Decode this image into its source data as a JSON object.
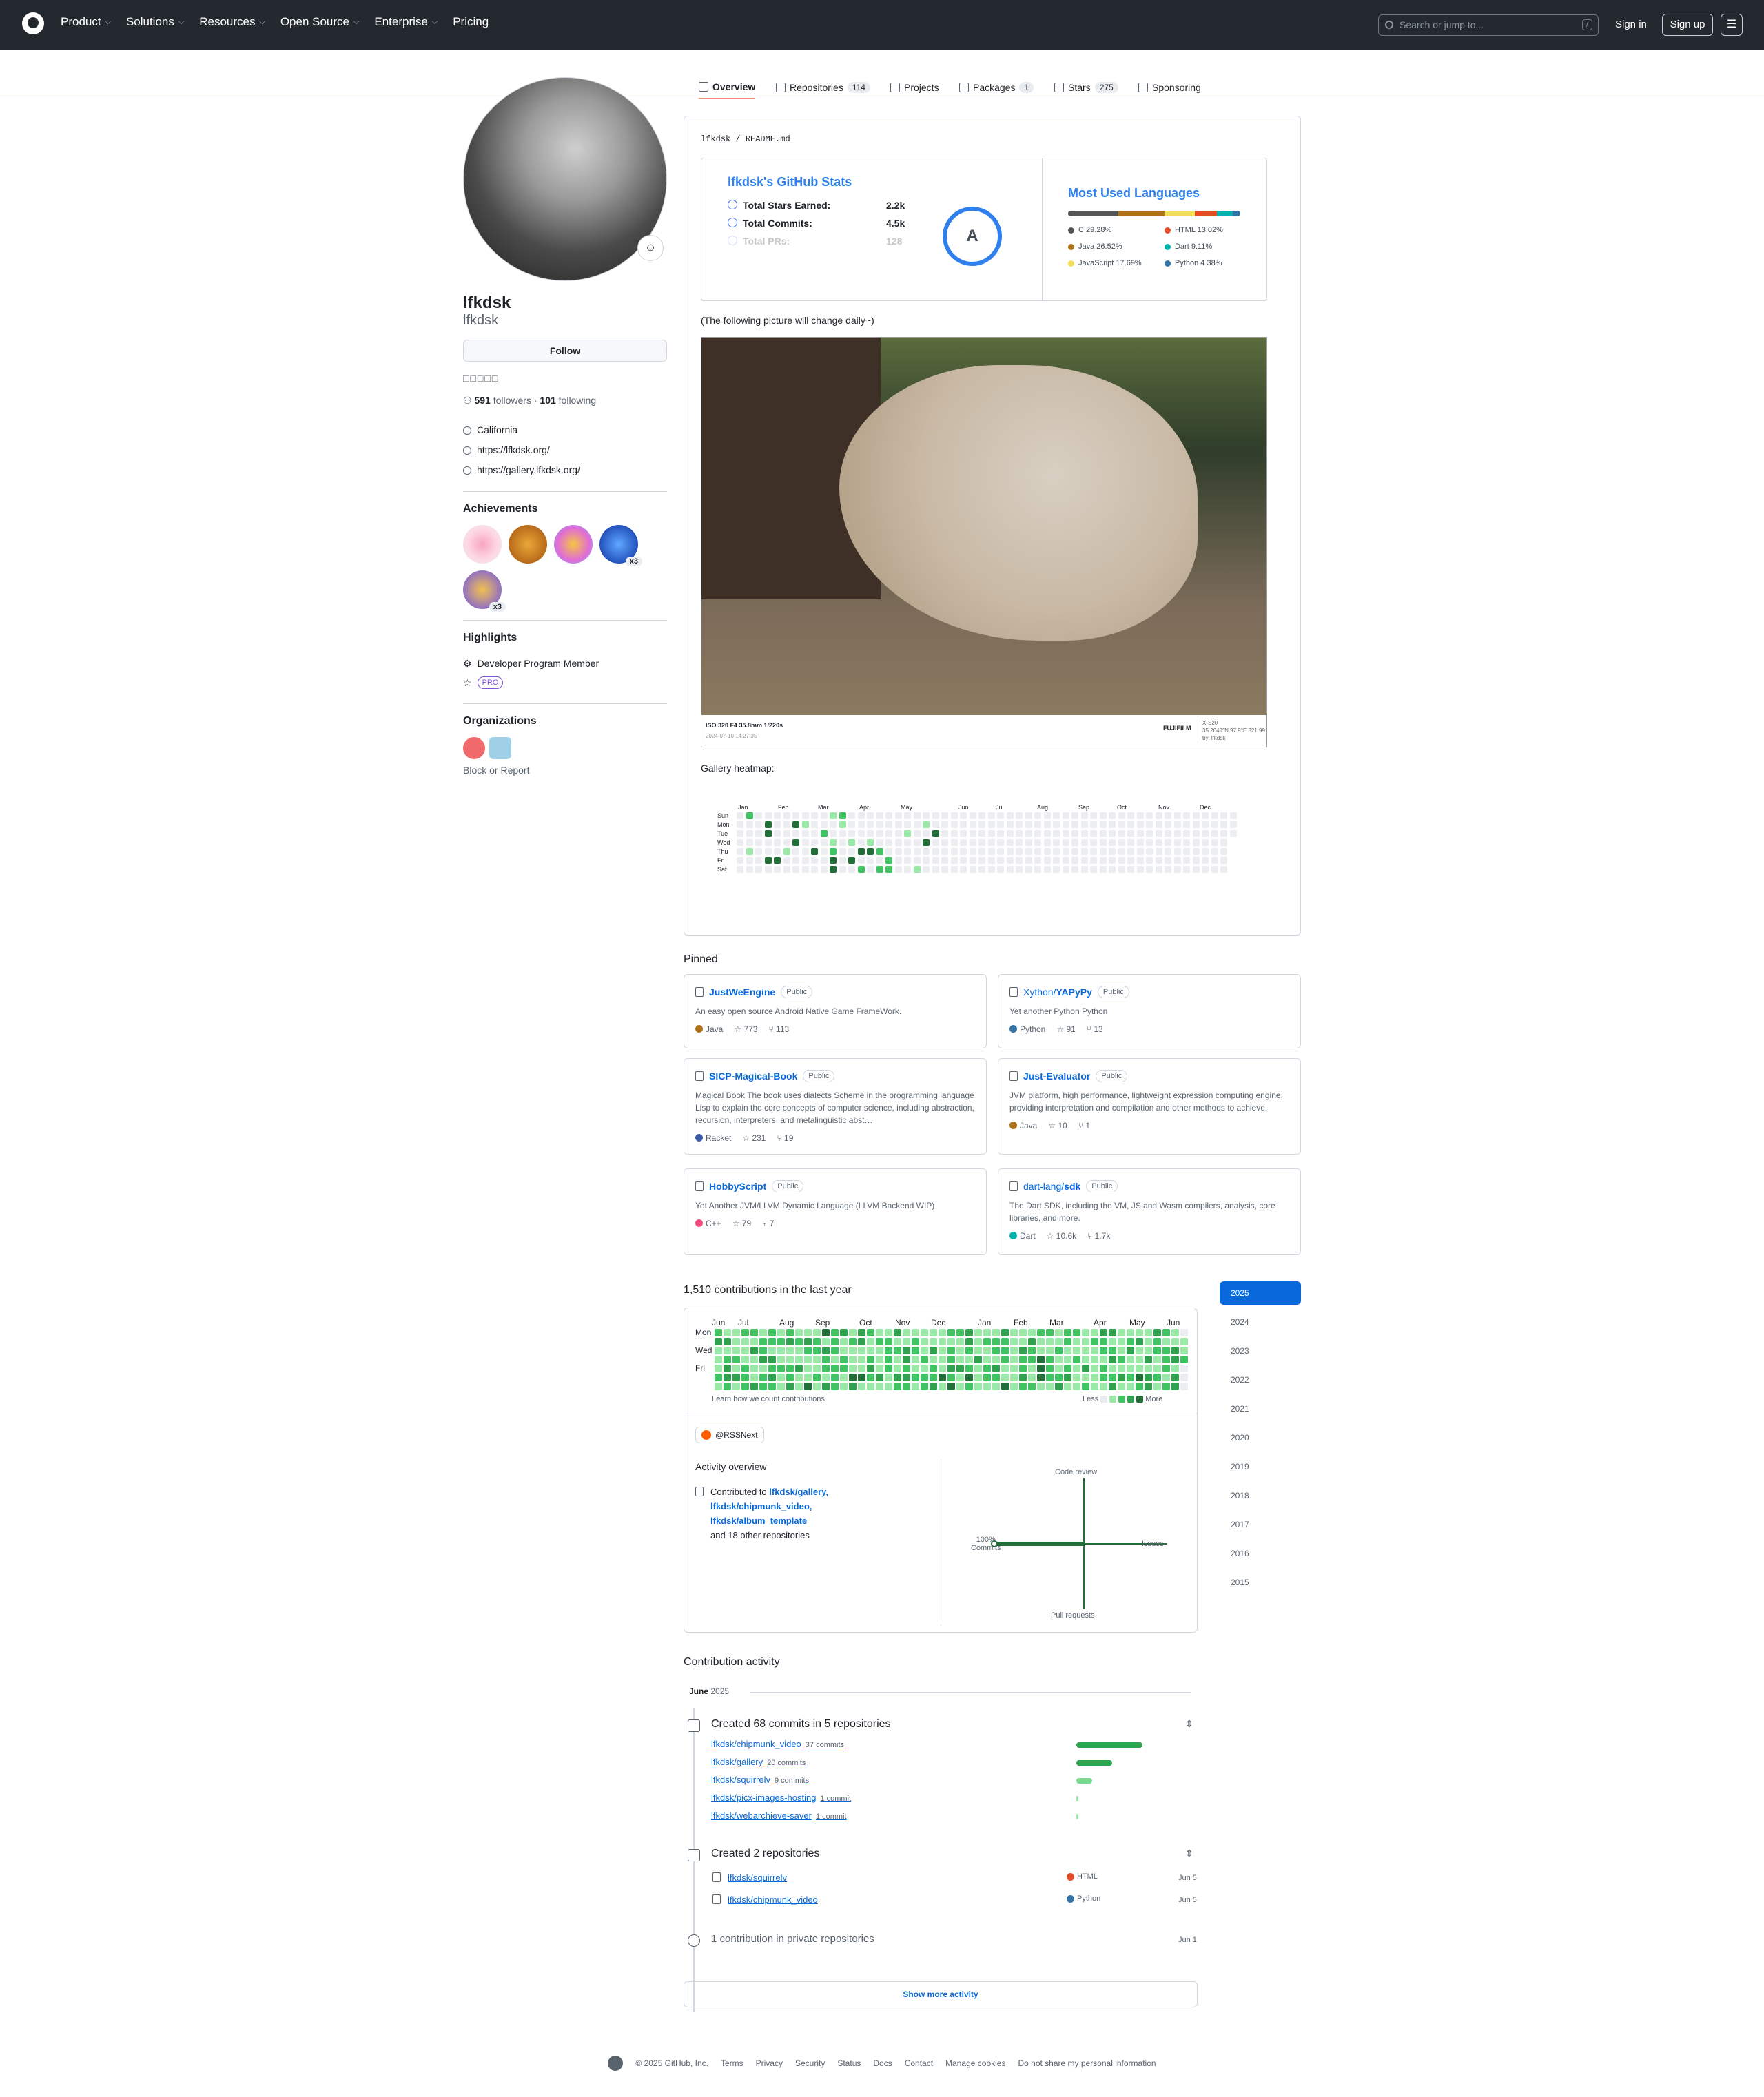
{
  "header": {
    "nav": [
      "Product",
      "Solutions",
      "Resources",
      "Open Source",
      "Enterprise",
      "Pricing"
    ],
    "search_placeholder": "Search or jump to...",
    "search_key": "/",
    "signin": "Sign in",
    "signup": "Sign up"
  },
  "tabs": [
    {
      "label": "Overview",
      "count": ""
    },
    {
      "label": "Repositories",
      "count": "114"
    },
    {
      "label": "Projects",
      "count": ""
    },
    {
      "label": "Packages",
      "count": "1"
    },
    {
      "label": "Stars",
      "count": "275"
    },
    {
      "label": "Sponsoring",
      "count": ""
    }
  ],
  "profile": {
    "name": "lfkdsk",
    "username": "lfkdsk",
    "follow": "Follow",
    "status": "□□□□□",
    "followers": "591",
    "followers_label": "followers",
    "following": "101",
    "following_label": "following",
    "location": "California",
    "links": [
      "https://lfkdsk.org/",
      "https://gallery.lfkdsk.org/"
    ],
    "achievements_title": "Achievements",
    "achievement_counts": [
      "x3",
      "x3"
    ],
    "highlights_title": "Highlights",
    "highlight_member": "Developer Program Member",
    "pro": "PRO",
    "orgs_title": "Organizations",
    "block": "Block or Report"
  },
  "readme": {
    "path_user": "lfkdsk",
    "path_file": "README.md",
    "stats_title": "lfkdsk's GitHub Stats",
    "stats": [
      {
        "label": "Total Stars Earned:",
        "value": "2.2k"
      },
      {
        "label": "Total Commits:",
        "value": "4.5k"
      },
      {
        "label": "Total PRs:",
        "value": "128"
      }
    ],
    "grade": "A",
    "lang_title": "Most Used Languages",
    "langs": [
      {
        "name": "C 29.28%",
        "color": "#555555",
        "pct": 29.28
      },
      {
        "name": "HTML 13.02%",
        "color": "#e34c26",
        "pct": 13.02
      },
      {
        "name": "Java 26.52%",
        "color": "#b07219",
        "pct": 26.52
      },
      {
        "name": "Dart 9.11%",
        "color": "#00b4ab",
        "pct": 9.11
      },
      {
        "name": "JavaScript 17.69%",
        "color": "#f1e05a",
        "pct": 17.69
      },
      {
        "name": "Python 4.38%",
        "color": "#3572a5",
        "pct": 4.38
      }
    ],
    "note": "(The following picture will change daily~)",
    "exif_main": "ISO 320 F4 35.8mm 1/220s",
    "exif_date": "2024-07-10 14:27:35",
    "exif_brand": "FUJIFILM",
    "exif_model": "X-S20",
    "exif_geo": "35.2048°N 97.9°E 321.99",
    "exif_by": "by: lfkdsk",
    "heatmap_label": "Gallery heatmap:",
    "heatmap_months": [
      "Jan",
      "Feb",
      "Mar",
      "Apr",
      "May",
      "Jun",
      "Jul",
      "Aug",
      "Sep",
      "Oct",
      "Nov",
      "Dec"
    ],
    "heatmap_days": [
      "Sun",
      "Mon",
      "Tue",
      "Wed",
      "Thu",
      "Fri",
      "Sat"
    ]
  },
  "pinned": {
    "title": "Pinned",
    "public": "Public",
    "items": [
      {
        "owner": "",
        "name": "JustWeEngine",
        "desc": "An easy open source Android Native Game FrameWork.",
        "lang": "Java",
        "color": "#b07219",
        "stars": "773",
        "forks": "113"
      },
      {
        "owner": "Xython/",
        "name": "YAPyPy",
        "desc": "Yet another Python Python",
        "lang": "Python",
        "color": "#3572a5",
        "stars": "91",
        "forks": "13"
      },
      {
        "owner": "",
        "name": "SICP-Magical-Book",
        "desc": "Magical Book The book uses dialects Scheme in the programming language Lisp to explain the core concepts of computer science, including abstraction, recursion, interpreters, and metalinguistic abst…",
        "lang": "Racket",
        "color": "#3c5caa",
        "stars": "231",
        "forks": "19"
      },
      {
        "owner": "",
        "name": "Just-Evaluator",
        "desc": "JVM platform, high performance, lightweight expression computing engine, providing interpretation and compilation and other methods to achieve.",
        "lang": "Java",
        "color": "#b07219",
        "stars": "10",
        "forks": "1"
      },
      {
        "owner": "",
        "name": "HobbyScript",
        "desc": "Yet Another JVM/LLVM Dynamic Language (LLVM Backend WIP)",
        "lang": "C++",
        "color": "#f34b7d",
        "stars": "79",
        "forks": "7"
      },
      {
        "owner": "dart-lang/",
        "name": "sdk",
        "desc": "The Dart SDK, including the VM, JS and Wasm compilers, analysis, core libraries, and more.",
        "lang": "Dart",
        "color": "#00b4ab",
        "stars": "10.6k",
        "forks": "1.7k"
      }
    ]
  },
  "contrib": {
    "title": "1,510 contributions in the last year",
    "months": [
      "Jun",
      "Jul",
      "Aug",
      "Sep",
      "Oct",
      "Nov",
      "Dec",
      "Jan",
      "Feb",
      "Mar",
      "Apr",
      "May",
      "Jun"
    ],
    "days": [
      "Mon",
      "Wed",
      "Fri"
    ],
    "learn": "Learn how we count contributions",
    "less": "Less",
    "more": "More",
    "org": "@RSSNext",
    "overview_title": "Activity overview",
    "contributed_to": "Contributed to",
    "repos": [
      "lfkdsk/gallery,",
      "lfkdsk/chipmunk_video,",
      "lfkdsk/album_template"
    ],
    "others": "and 18 other repositories",
    "axes": {
      "top": "Code review",
      "bottom": "Pull requests",
      "right": "Issues",
      "left_pct": "100%",
      "left": "Commits"
    }
  },
  "years": [
    "2025",
    "2024",
    "2023",
    "2022",
    "2021",
    "2020",
    "2019",
    "2018",
    "2017",
    "2016",
    "2015"
  ],
  "activity": {
    "title": "Contribution activity",
    "month": "June",
    "year": "2025",
    "commits_title": "Created 68 commits in 5 repositories",
    "commit_repos": [
      {
        "name": "lfkdsk/chipmunk_video",
        "count": "37 commits",
        "value": 37
      },
      {
        "name": "lfkdsk/gallery",
        "count": "20 commits",
        "value": 20
      },
      {
        "name": "lfkdsk/squirrelv",
        "count": "9 commits",
        "value": 9
      },
      {
        "name": "lfkdsk/picx-images-hosting",
        "count": "1 commit",
        "value": 1
      },
      {
        "name": "lfkdsk/webarchieve-saver",
        "count": "1 commit",
        "value": 1
      }
    ],
    "created_title": "Created 2 repositories",
    "created": [
      {
        "name": "lfkdsk/squirrelv",
        "lang": "HTML",
        "color": "#e34c26",
        "date": "Jun 5"
      },
      {
        "name": "lfkdsk/chipmunk_video",
        "lang": "Python",
        "color": "#3572a5",
        "date": "Jun 5"
      }
    ],
    "private": "1 contribution in private repositories",
    "private_date": "Jun 1",
    "show_more": "Show more activity"
  },
  "footer": [
    "© 2025 GitHub, Inc.",
    "Terms",
    "Privacy",
    "Security",
    "Status",
    "Docs",
    "Contact",
    "Manage cookies",
    "Do not share my personal information"
  ]
}
